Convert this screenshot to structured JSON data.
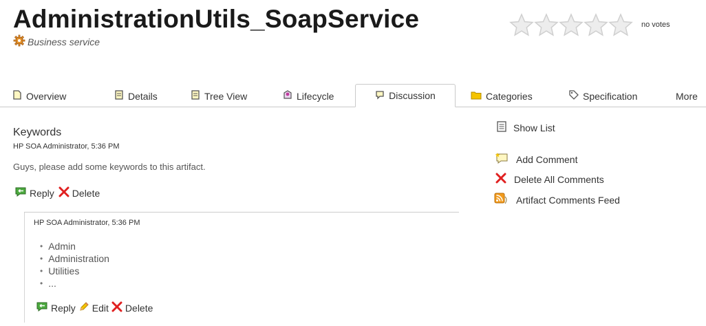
{
  "header": {
    "title": "AdministrationUtils_SoapService",
    "subtitle": "Business service",
    "votes_label": "no votes",
    "rating_stars": 5,
    "rating_value": 0
  },
  "tabs": [
    {
      "label": "Overview",
      "icon": "document-icon"
    },
    {
      "label": "Details",
      "icon": "details-icon"
    },
    {
      "label": "Tree View",
      "icon": "tree-view-icon"
    },
    {
      "label": "Lifecycle",
      "icon": "lifecycle-icon"
    },
    {
      "label": "Discussion",
      "icon": "comment-icon",
      "active": true
    },
    {
      "label": "Categories",
      "icon": "folder-icon"
    },
    {
      "label": "Specification",
      "icon": "tag-icon"
    },
    {
      "label": "More",
      "icon": ""
    }
  ],
  "discussion": {
    "topic_title": "Keywords",
    "post": {
      "author_time": "HP SOA Administrator, 5:36 PM",
      "text": "Guys, please add some keywords to this artifact.",
      "reply_label": "Reply",
      "delete_label": "Delete"
    },
    "reply": {
      "author_time": "HP SOA Administrator, 5:36 PM",
      "items": [
        "Admin",
        "Administration",
        "Utilities",
        "..."
      ],
      "reply_label": "Reply",
      "edit_label": "Edit",
      "delete_label": "Delete"
    }
  },
  "sidebar": {
    "show_list": "Show List",
    "add_comment": "Add Comment",
    "delete_all": "Delete All Comments",
    "feed": "Artifact Comments Feed"
  },
  "colors": {
    "accent_red": "#e02020",
    "feed_orange": "#f29b1c",
    "folder_yellow": "#f5c400",
    "star_gray": "#dcdcdc"
  }
}
